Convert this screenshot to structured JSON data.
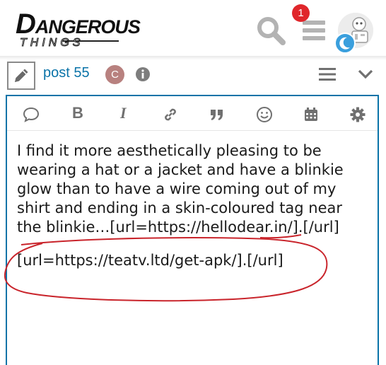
{
  "header": {
    "logo_first_letter": "D",
    "logo_rest": "ANGEROUS",
    "logo_subtitle": "THINGS",
    "notification_count": "1",
    "icons": [
      "search-icon",
      "hamburger-menu-icon",
      "avatar",
      "moon-icon"
    ]
  },
  "composer": {
    "post_label": "post 55",
    "user_initial": "C",
    "icons": [
      "pencil-icon",
      "info-icon",
      "hamburger-menu-icon",
      "chevron-down-icon"
    ]
  },
  "toolbar": {
    "bold_label": "B",
    "italic_label": "I",
    "quote_label": "”",
    "icons": [
      "speech-bubble-icon",
      "bold-icon",
      "italic-icon",
      "link-icon",
      "quote-icon",
      "emoji-icon",
      "calendar-icon",
      "gear-icon"
    ]
  },
  "editor": {
    "paragraph1": "I find it more aesthetically pleasing to be wearing a hat or a jacket and have a blinkie glow than to have a wire coming out of my shirt and ending in a skin-coloured tag near the blinkie…[url=https://hellodear.in/].[/url]",
    "paragraph2": "[url=https://teatv.ltd/get-apk/].[/url]"
  },
  "colors": {
    "accent": "#0a73a8",
    "badge_red": "#e0262b",
    "annotation_red": "#c9242b",
    "avatar_c": "#b8817f"
  }
}
